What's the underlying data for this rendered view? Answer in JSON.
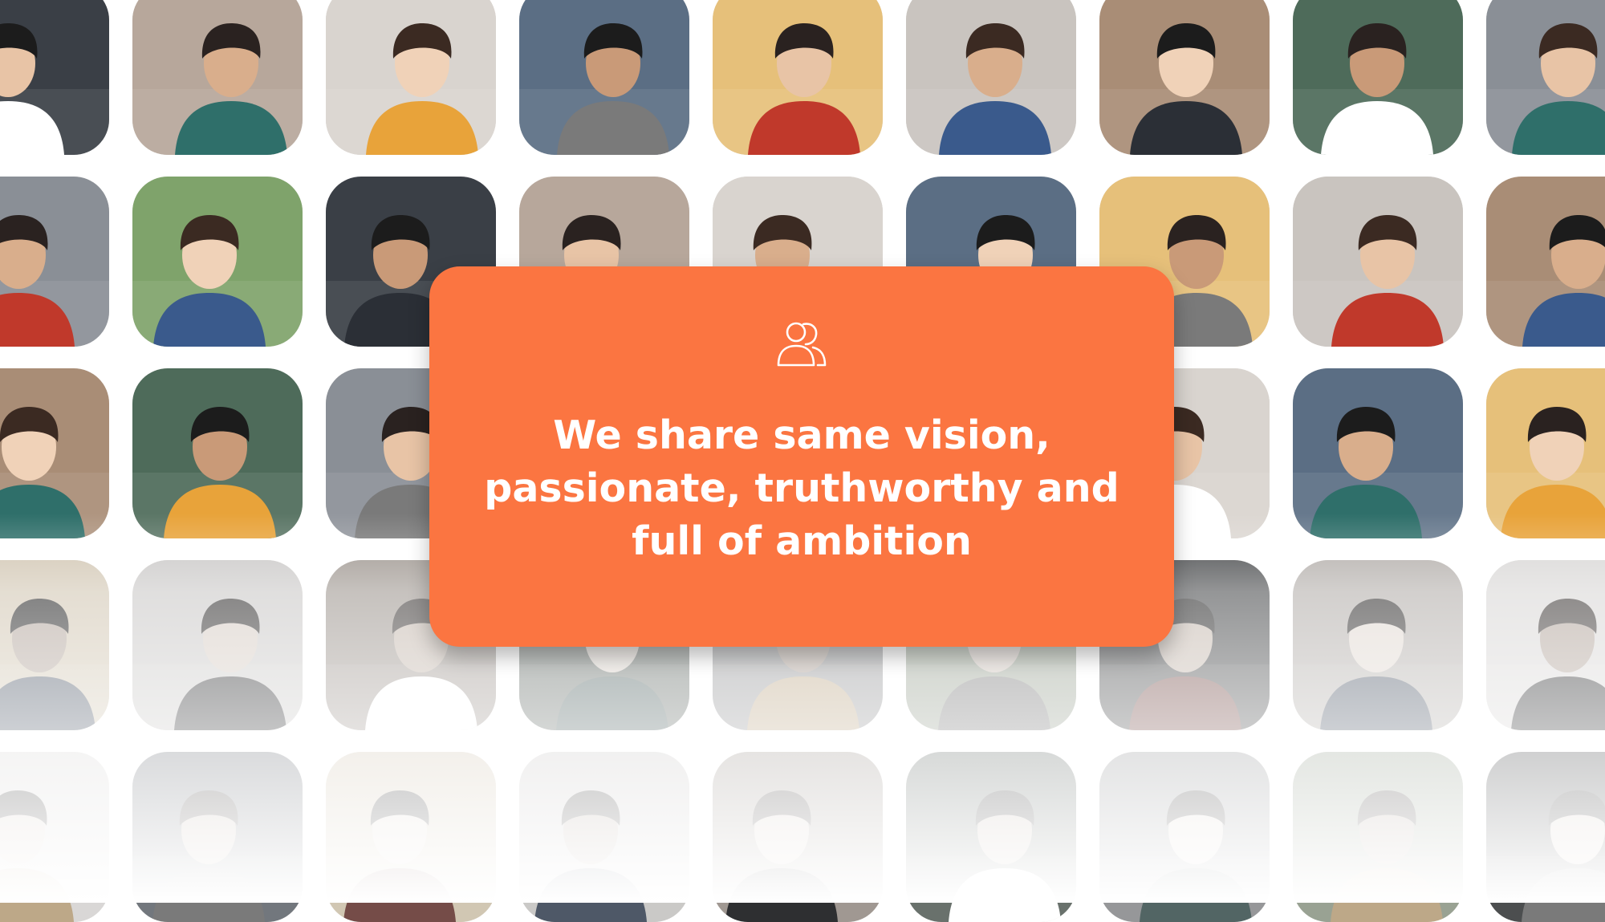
{
  "card": {
    "icon": "users-icon",
    "title": "We share same vision, passionate, truthworthy and full of ambition",
    "color": "#fb7541"
  },
  "grid": {
    "rows": 5,
    "cols": 9,
    "tile_color_tones": [
      "#3a3f46",
      "#5b6e84",
      "#a98d76",
      "#7fa36b",
      "#d9d4cf",
      "#c9c4bf",
      "#8a8f96",
      "#b7a79b",
      "#e6c07a",
      "#4e6b5a"
    ]
  }
}
